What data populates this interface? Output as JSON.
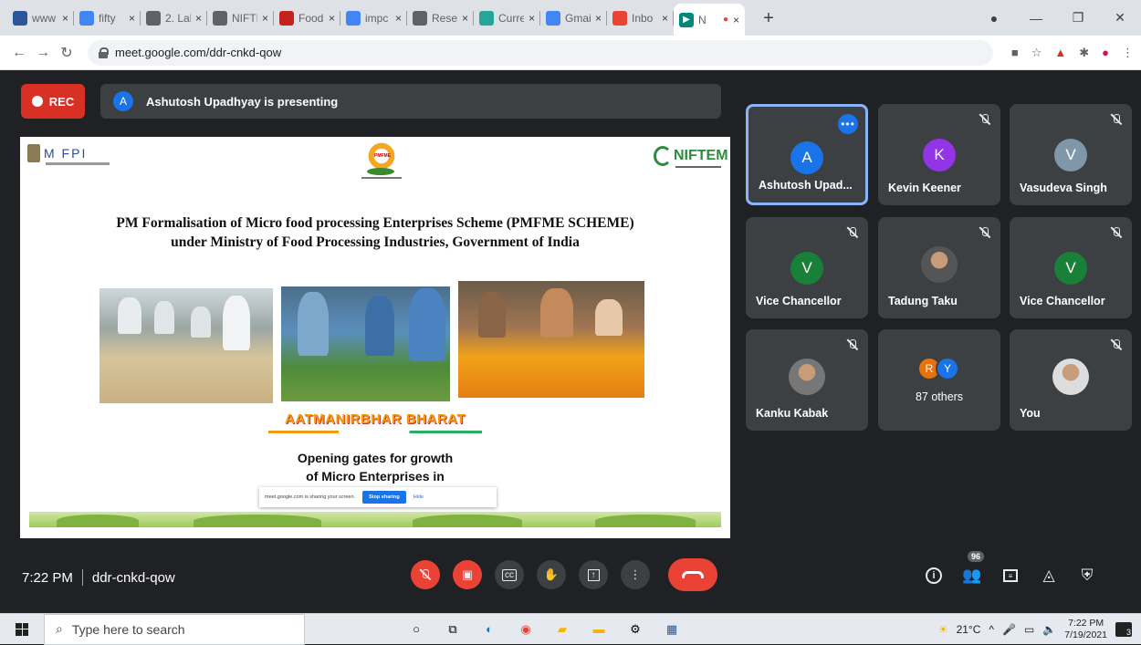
{
  "browser": {
    "tabs": [
      {
        "label": "www",
        "icon": "email-icon",
        "color": "#2b579a"
      },
      {
        "label": "fifty",
        "icon": "google-icon",
        "color": "#4285f4"
      },
      {
        "label": "2. Lal",
        "icon": "globe-icon",
        "color": "#5f6368"
      },
      {
        "label": "NIFTI",
        "icon": "globe-icon",
        "color": "#5f6368"
      },
      {
        "label": "Food",
        "icon": "slides-icon",
        "color": "#c5221f"
      },
      {
        "label": "impc",
        "icon": "google-icon",
        "color": "#4285f4"
      },
      {
        "label": "Rese",
        "icon": "globe-icon",
        "color": "#5f6368"
      },
      {
        "label": "Curre",
        "icon": "r-icon",
        "color": "#26a69a"
      },
      {
        "label": "Gmai",
        "icon": "google-icon",
        "color": "#4285f4"
      },
      {
        "label": "Inbo",
        "icon": "gmail-icon",
        "color": "#ea4335"
      }
    ],
    "active_tab": {
      "label": "N",
      "icon": "meet-icon"
    },
    "new_tab": "+",
    "close_glyph": "×",
    "url": "meet.google.com/ddr-cnkd-qow"
  },
  "meeting": {
    "rec_label": "REC",
    "presenter_initial": "A",
    "presenting_text": "Ashutosh Upadhyay is presenting",
    "time": "7:22 PM",
    "code": "ddr-cnkd-qow",
    "participants_count": "96"
  },
  "slide": {
    "logo_left": "M FPI",
    "logo_center": "PMFME",
    "logo_right": "NIFTEM",
    "title_line1": "PM Formalisation of Micro food processing Enterprises Scheme (PMFME SCHEME)",
    "title_line2": "under Ministry of Food Processing Industries, Government of India",
    "tagline": "AATMANIRBHAR BHARAT",
    "subtitle_line1": "Opening gates for growth",
    "subtitle_line2": "of Micro Enterprises in",
    "share_text": "meet.google.com is sharing your screen.",
    "stop_sharing": "Stop sharing",
    "hide": "Hide"
  },
  "participants": [
    {
      "name": "Ashutosh Upad...",
      "initial": "A",
      "color": "#1a73e8",
      "active": true
    },
    {
      "name": "Kevin Keener",
      "initial": "K",
      "color": "#9334e6"
    },
    {
      "name": "Vasudeva Singh",
      "initial": "V",
      "color": "#7f97a8"
    },
    {
      "name": "Vice Chancellor",
      "initial": "V",
      "color": "#188038"
    },
    {
      "name": "Tadung Taku",
      "initial": "",
      "color": "#555"
    },
    {
      "name": "Vice Chancellor",
      "initial": "V",
      "color": "#188038"
    },
    {
      "name": "Kanku Kabak",
      "initial": "",
      "color": "#777"
    },
    {
      "name": "87 others",
      "initial": "",
      "color": ""
    },
    {
      "name": "You",
      "initial": "",
      "color": "#ddd"
    }
  ],
  "others_initials": [
    "R",
    "Y"
  ],
  "taskbar": {
    "search_placeholder": "Type here to search",
    "temperature": "21°C",
    "clock_time": "7:22 PM",
    "clock_date": "7/19/2021",
    "notifications": "3"
  }
}
